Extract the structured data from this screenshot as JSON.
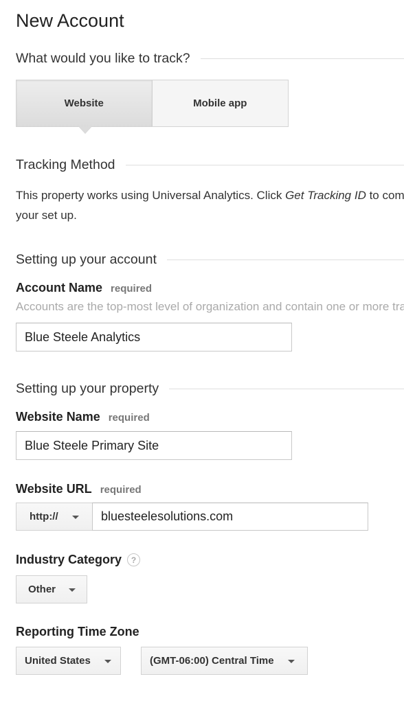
{
  "page": {
    "title": "New Account"
  },
  "track": {
    "section_label": "What would you like to track?",
    "options": [
      {
        "label": "Website",
        "selected": true
      },
      {
        "label": "Mobile app",
        "selected": false
      }
    ]
  },
  "tracking_method": {
    "section_label": "Tracking Method",
    "text_before": "This property works using Universal Analytics. Click ",
    "text_emphasis": "Get Tracking ID",
    "text_after": " to complete your set up."
  },
  "account": {
    "section_label": "Setting up your account",
    "name_label": "Account Name",
    "required_label": "required",
    "help_text": "Accounts are the top-most level of organization and contain one or more tracking IDs.",
    "name_value": "Blue Steele Analytics"
  },
  "property": {
    "section_label": "Setting up your property",
    "website_name_label": "Website Name",
    "website_name_required": "required",
    "website_name_value": "Blue Steele Primary Site",
    "url_label": "Website URL",
    "url_required": "required",
    "protocol_selected": "http://",
    "url_value": "bluesteelesolutions.com",
    "industry_label": "Industry Category",
    "industry_help": "?",
    "industry_selected": "Other",
    "timezone_label": "Reporting Time Zone",
    "country_selected": "United States",
    "timezone_selected": "(GMT-06:00) Central Time"
  },
  "icons": {
    "help": "question-circle-icon",
    "caret": "caret-down-icon"
  }
}
